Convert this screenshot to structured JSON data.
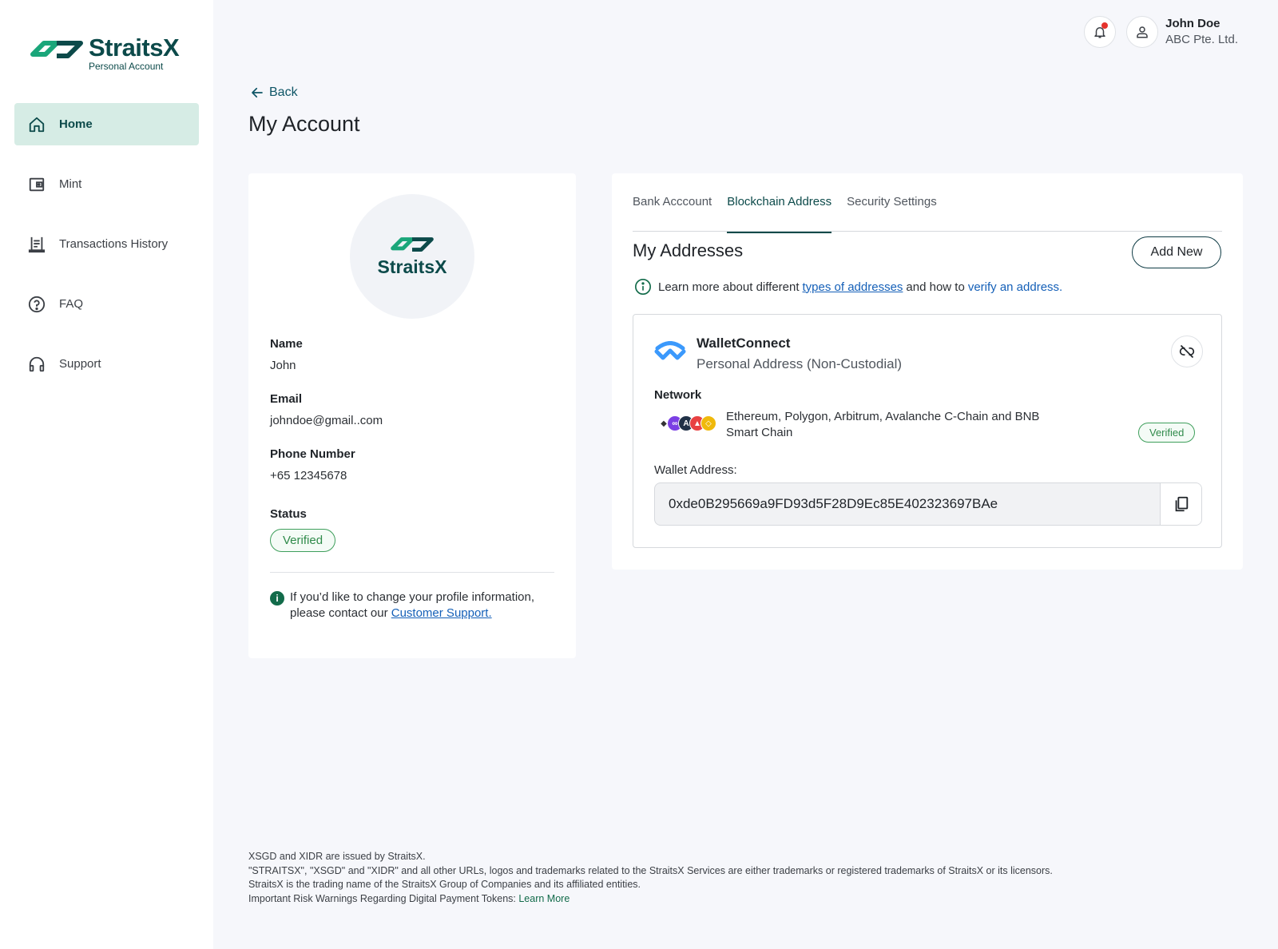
{
  "brand": {
    "name": "StraitsX",
    "subtitle": "Personal Account",
    "primary_color": "#0c4a4a",
    "accent_color": "#1aa67a"
  },
  "sidebar": {
    "items": [
      {
        "label": "Home",
        "icon": "home-icon",
        "active": true
      },
      {
        "label": "Mint",
        "icon": "wallet-icon",
        "active": false
      },
      {
        "label": "Transactions History",
        "icon": "receipt-icon",
        "active": false
      },
      {
        "label": "FAQ",
        "icon": "help-circle-icon",
        "active": false
      },
      {
        "label": "Support",
        "icon": "headset-icon",
        "active": false
      }
    ]
  },
  "topbar": {
    "user_name": "John Doe",
    "user_org": "ABC Pte. Ltd.",
    "notification_icon": "bell-icon",
    "avatar_icon": "user-icon"
  },
  "header": {
    "back_label": "Back",
    "title": "My Account"
  },
  "profile": {
    "logo_text": "StraitsX",
    "name_label": "Name",
    "name_value": "John",
    "email_label": "Email",
    "email_value": "johndoe@gmail..com",
    "phone_label": "Phone Number",
    "phone_value": "+65 12345678",
    "status_label": "Status",
    "status_value": "Verified",
    "note_text": "If you’d like to change your profile information, please contact our",
    "note_link": "Customer Support."
  },
  "tabs": [
    {
      "label": "Bank Acccount",
      "active": false
    },
    {
      "label": "Blockchain Address",
      "active": true
    },
    {
      "label": "Security Settings",
      "active": false
    }
  ],
  "addresses": {
    "title": "My Addresses",
    "add_new_label": "Add New",
    "info_prefix": "Learn more about different",
    "info_link1": "types of addresses",
    "info_middle": "and how to",
    "info_link2": "verify an address.",
    "wallet": {
      "name": "WalletConnect",
      "type": "Personal Address (Non-Custodial)",
      "network_label": "Network",
      "networks": "Ethereum, Polygon, Arbitrum, Avalanche C-Chain and BNB Smart Chain",
      "status": "Verified",
      "address_label": "Wallet Address:",
      "address": "0xde0B295669a9FD93d5F28D9Ec85E402323697BAe"
    }
  },
  "footer": {
    "line1": "XSGD and XIDR are issued by StraitsX.",
    "line2": "\"STRAITSX\", \"XSGD\" and \"XIDR\" and all other URLs, logos and trademarks related to the StraitsX Services are either trademarks or registered trademarks of StraitsX or its licensors.",
    "line3": "StraitsX is the trading name of the StraitsX Group of Companies and its affiliated entities.",
    "line4": "Important Risk Warnings Regarding Digital Payment Tokens:",
    "learn_more": "Learn More"
  }
}
